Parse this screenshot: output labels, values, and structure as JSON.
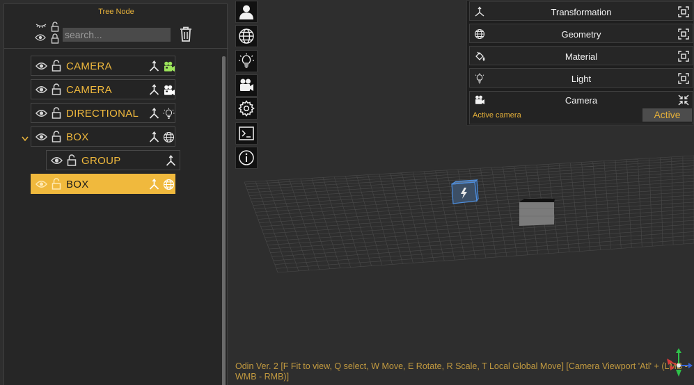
{
  "tree": {
    "title": "Tree Node",
    "search_placeholder": "search...",
    "nodes": [
      {
        "label": "CAMERA",
        "kind": "camera",
        "kind_color": "#9be35a",
        "selected": false
      },
      {
        "label": "CAMERA",
        "kind": "camera",
        "kind_color": "#ffffff",
        "selected": false
      },
      {
        "label": "DIRECTIONAL",
        "kind": "light",
        "kind_color": "#e8e8e8",
        "selected": false
      },
      {
        "label": "BOX",
        "kind": "geometry",
        "kind_color": "#e8e8e8",
        "selected": false,
        "expanded": true
      },
      {
        "label": "GROUP",
        "kind": "group",
        "kind_color": "#e8e8e8",
        "selected": false
      },
      {
        "label": "BOX",
        "kind": "geometry",
        "kind_color": "#ffffff",
        "selected": true
      }
    ]
  },
  "tools": [
    {
      "name": "user-icon"
    },
    {
      "name": "globe-icon"
    },
    {
      "name": "lightbulb-icon"
    },
    {
      "name": "camera-icon"
    },
    {
      "name": "gear-icon"
    },
    {
      "name": "terminal-icon"
    },
    {
      "name": "info-icon"
    }
  ],
  "properties": {
    "transformation": "Transformation",
    "geometry": "Geometry",
    "material": "Material",
    "light": "Light",
    "camera": "Camera",
    "active_camera_label": "Active camera",
    "active_button": "Active"
  },
  "status": "Odin Ver. 2 [F Fit to view, Q select, W Move, E Rotate, R Scale, T Local Global Move] [Camera Viewport 'Atl' + (LMB - WMB - RMB)]",
  "colors": {
    "accent": "#f0b93d",
    "background": "#2e2e2e",
    "panel": "#262626",
    "selection_box": "#4d8fe0"
  }
}
